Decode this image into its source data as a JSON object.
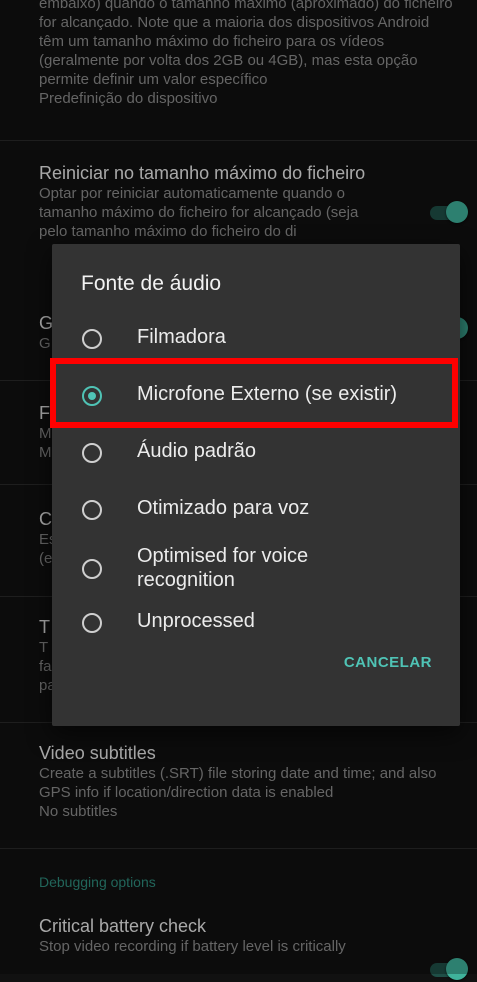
{
  "settings": {
    "top_desc": "embaixo) quando o tamanho máximo (aproximado) do ficheiro for alcançado. Note que a maioria dos dispositivos Android têm um tamanho máximo do ficheiro para os vídeos (geralmente por volta dos 2GB ou 4GB), mas esta opção permite definir um valor específico",
    "top_value": "Predefinição do dispositivo",
    "restart": {
      "title": "Reiniciar no tamanho máximo do ficheiro",
      "desc": "Optar por reiniciar automaticamente quando o tamanho máximo do ficheiro for alcançado (seja pelo tamanho máximo do ficheiro do di",
      "toggle_on": true
    },
    "partial_letters": [
      "G",
      "G",
      "F",
      "M",
      "M",
      "C",
      "Es",
      "(e",
      "T",
      "T",
      "fa",
      "pa"
    ],
    "video_subtitles": {
      "title": "Video subtitles",
      "desc": "Create a subtitles (.SRT) file storing date and time; and also GPS info if location/direction data is enabled",
      "value": "No subtitles"
    },
    "debugging_header": "Debugging options",
    "battery": {
      "title": "Critical battery check",
      "desc": "Stop video recording if battery level is critically",
      "toggle_on": true
    }
  },
  "dialog": {
    "title": "Fonte de áudio",
    "options": [
      {
        "label": "Filmadora",
        "selected": false
      },
      {
        "label": "Microfone Externo (se existir)",
        "selected": true
      },
      {
        "label": "Áudio padrão",
        "selected": false
      },
      {
        "label": "Otimizado para voz",
        "selected": false
      },
      {
        "label": "Optimised for voice recognition",
        "selected": false
      },
      {
        "label": "Unprocessed",
        "selected": false
      }
    ],
    "cancel_label": "CANCELAR"
  },
  "colors": {
    "accent": "#4fc3b5",
    "highlight_border": "#ff0000",
    "dialog_bg": "#333333",
    "page_bg": "#111111"
  }
}
